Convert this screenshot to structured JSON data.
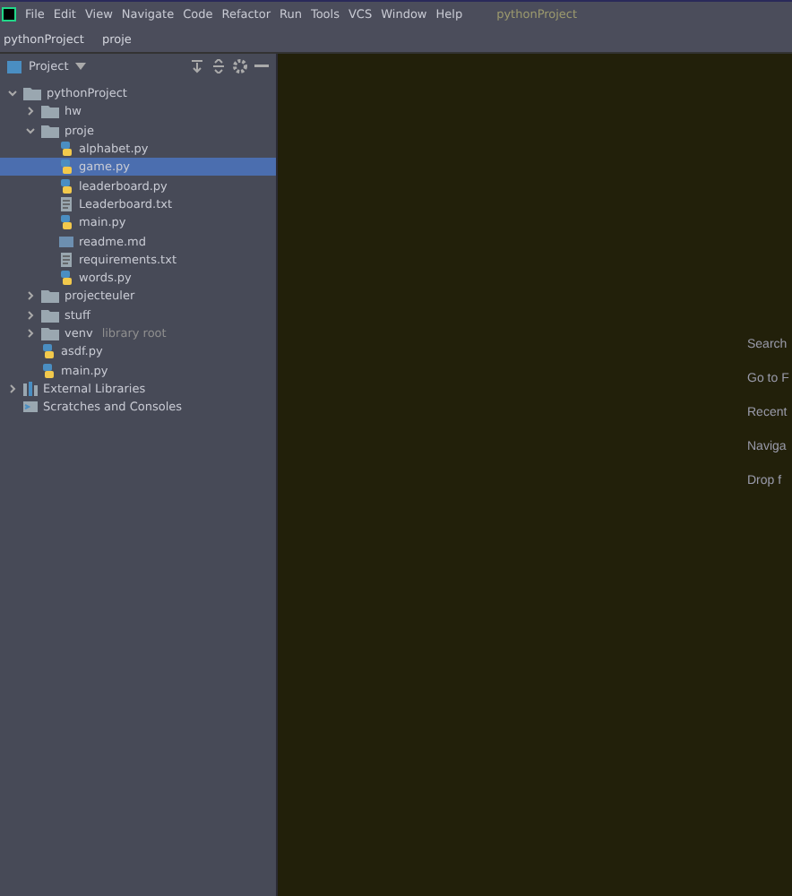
{
  "menu_bar": [
    "File",
    "Edit",
    "View",
    "Navigate",
    "Code",
    "Refactor",
    "Run",
    "Tools",
    "VCS",
    "Window",
    "Help"
  ],
  "window": {
    "title": "pythonProject"
  },
  "breadcrumbs": [
    "pythonProject",
    "proje"
  ],
  "project_panel": {
    "title": "Project",
    "tree": [
      {
        "label": "pythonProject",
        "kind": "folder",
        "expanded": true,
        "selected": false,
        "children": [
          {
            "label": "hw",
            "kind": "folder",
            "expanded": false,
            "selected": false
          },
          {
            "label": "proje",
            "kind": "folder",
            "expanded": true,
            "selected": false,
            "children": [
              {
                "label": "alphabet.py",
                "kind": "python",
                "selected": false
              },
              {
                "label": "game.py",
                "kind": "python",
                "selected": true
              },
              {
                "label": "leaderboard.py",
                "kind": "python",
                "selected": false
              },
              {
                "label": "Leaderboard.txt",
                "kind": "text",
                "selected": false
              },
              {
                "label": "main.py",
                "kind": "python",
                "selected": false
              },
              {
                "label": "readme.md",
                "kind": "markdown",
                "selected": false
              },
              {
                "label": "requirements.txt",
                "kind": "text",
                "selected": false
              },
              {
                "label": "words.py",
                "kind": "python",
                "selected": false
              }
            ]
          },
          {
            "label": "projecteuler",
            "kind": "folder",
            "expanded": false,
            "selected": false
          },
          {
            "label": "stuff",
            "kind": "folder",
            "expanded": false,
            "selected": false
          },
          {
            "label": "venv",
            "note": "library root",
            "kind": "folder",
            "expanded": false,
            "selected": false
          },
          {
            "label": "asdf.py",
            "kind": "python",
            "selected": false
          },
          {
            "label": "main.py",
            "kind": "python",
            "selected": false
          }
        ]
      },
      {
        "label": "External Libraries",
        "kind": "libraries",
        "expanded": false,
        "selected": false
      },
      {
        "label": "Scratches and Consoles",
        "kind": "scratches",
        "selected": false
      }
    ]
  },
  "editor_hints": [
    "Search",
    "Go to F",
    "Recent",
    "Naviga",
    "Drop f"
  ]
}
